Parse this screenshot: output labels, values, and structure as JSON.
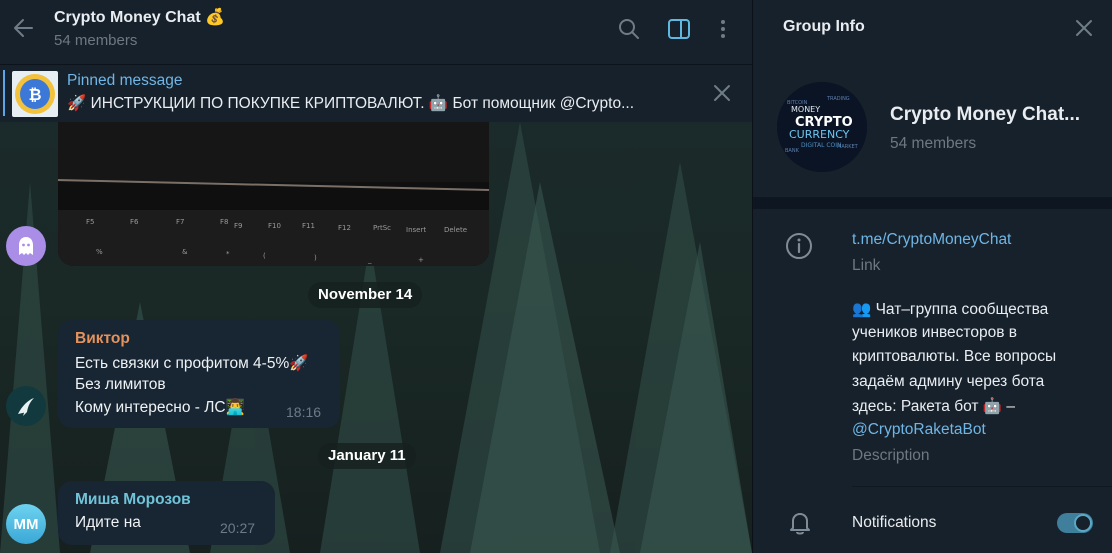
{
  "chat": {
    "title": "Crypto Money Chat 💰",
    "subtitle": "54 members",
    "pinned": {
      "label": "Pinned message",
      "text": "🚀 ИНСТРУКЦИИ ПО ПОКУПКЕ КРИПТОВАЛЮТ.  🤖 Бот помощник  @Crypto..."
    },
    "dates": [
      "November 14",
      "January 11"
    ],
    "messages": [
      {
        "sender": "Виктор",
        "sender_color": "#e5925b",
        "lines": [
          "Есть связки с профитом 4-5%🚀",
          "Без лимитов",
          "Кому интересно - ЛС👨‍💻"
        ],
        "time": "18:16"
      },
      {
        "sender": "Миша Морозов",
        "sender_color": "#6fc4d8",
        "avatar_initials": "MM",
        "lines": [
          "Идите на"
        ],
        "time": "20:27"
      }
    ],
    "keyboard_keys": [
      "F5",
      "F6",
      "F7",
      "F8",
      "F9",
      "F10",
      "F11",
      "F12",
      "PrtSc",
      "Insert",
      "Delete",
      "%",
      "&",
      "*",
      "(",
      ")",
      "_",
      "+"
    ]
  },
  "info": {
    "panel_title": "Group Info",
    "group_name": "Crypto Money Chat...",
    "members": "54 members",
    "link": "t.me/CryptoMoneyChat",
    "link_label": "Link",
    "description_lines": [
      "👥 Чат–группа сообщества",
      "учеников инвесторов в",
      "криптовалюты. Все вопросы",
      "задаём админу через бота",
      "здесь: Ракета бот 🤖 –"
    ],
    "description_mention": "@CryptoRaketaBot",
    "description_label": "Description",
    "notifications_label": "Notifications",
    "notifications_on": true,
    "avatar_words": [
      "MONEY",
      "CRYPTO",
      "CURRENCY",
      "DIGITAL COIN"
    ]
  },
  "colors": {
    "accent": "#6fb6e6",
    "panel": "#17212b",
    "bubble": "#182533"
  },
  "icons": [
    "back-arrow-icon",
    "search-icon",
    "sidebar-toggle-icon",
    "more-vertical-icon",
    "close-icon",
    "info-icon",
    "bell-icon",
    "ghost-icon"
  ]
}
